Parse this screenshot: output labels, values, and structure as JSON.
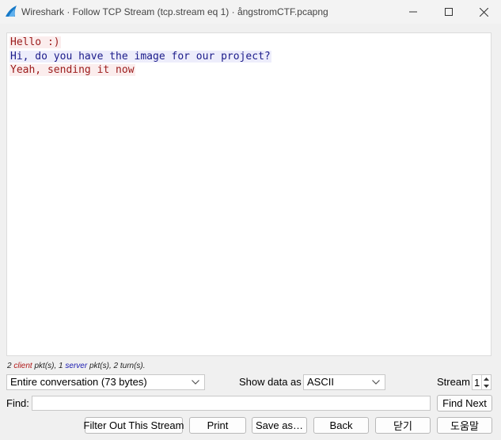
{
  "window": {
    "title": "Wireshark · Follow TCP Stream (tcp.stream eq 1) · ångstromCTF.pcapng",
    "app_icon": "wireshark-fin-icon",
    "controls": [
      "minimize-icon",
      "maximize-icon",
      "close-icon"
    ]
  },
  "stream": {
    "lines": [
      {
        "side": "client",
        "text": "Hello :)"
      },
      {
        "side": "server",
        "text": "Hi, do you have the image for our project?"
      },
      {
        "side": "client",
        "text": "Yeah, sending it now"
      }
    ],
    "colors": {
      "client_text": "#9b1b1b",
      "client_bg": "#fbeded",
      "server_text": "#1b1b8a",
      "server_bg": "#ededfb"
    }
  },
  "summary": {
    "client_count": "2",
    "client_word": "client",
    "client_suffix": " pkt(s), ",
    "server_count": "1",
    "server_word": "server",
    "server_suffix": " pkt(s), 2 turn(s)."
  },
  "controls": {
    "conversation_select": "Entire conversation (73 bytes)",
    "show_data_label": "Show data as",
    "show_data_select": "ASCII",
    "stream_label": "Stream",
    "stream_value": "1",
    "find_label": "Find:",
    "find_value": "",
    "find_next": "Find Next"
  },
  "buttons": {
    "filter_out": "Filter Out This Stream",
    "print": "Print",
    "save_as": "Save as…",
    "back": "Back",
    "close": "닫기",
    "help": "도움말"
  }
}
